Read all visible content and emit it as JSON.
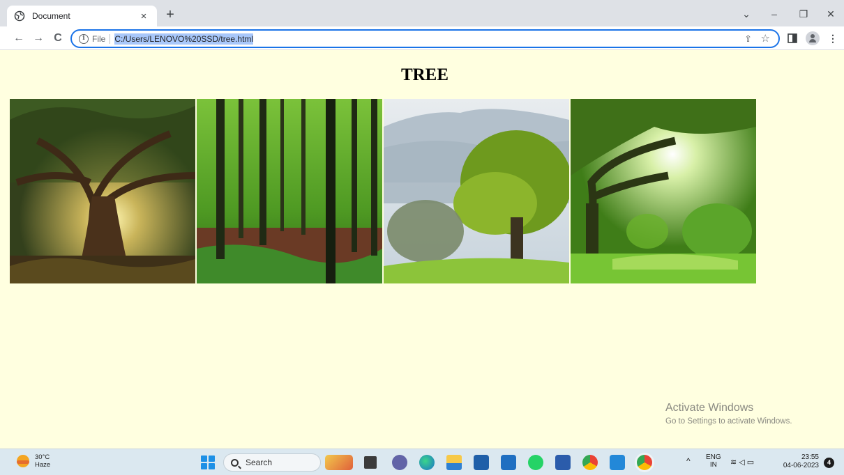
{
  "browser": {
    "tab_title": "Document",
    "tab_close": "×",
    "new_tab": "+",
    "window_controls": {
      "dropdown": "⌄",
      "minimize": "–",
      "restore": "❐",
      "close": "✕"
    },
    "nav": {
      "back": "←",
      "forward": "→",
      "reload": "C"
    },
    "address": {
      "scheme_label": "File",
      "url": "C:/Users/LENOVO%20SSD/tree.html"
    }
  },
  "page": {
    "heading": "TREE",
    "images": [
      {
        "subject": "old oak tree with sun"
      },
      {
        "subject": "forest of tall trunks"
      },
      {
        "subject": "oak on hillside with mountains"
      },
      {
        "subject": "spreading tree over sunlit meadow"
      }
    ],
    "watermark": {
      "line1": "Activate Windows",
      "line2": "Go to Settings to activate Windows."
    }
  },
  "taskbar": {
    "weather": {
      "temp": "30°C",
      "condition": "Haze"
    },
    "search_label": "Search",
    "tray": {
      "lang": "ENG",
      "region": "IN",
      "time": "23:55",
      "date": "04-06-2023",
      "notifications": "4"
    }
  },
  "colors": {
    "page_bg": "#ffffe0",
    "accent": "#1a73e8",
    "taskbar_bg": "#dbe8f0"
  }
}
